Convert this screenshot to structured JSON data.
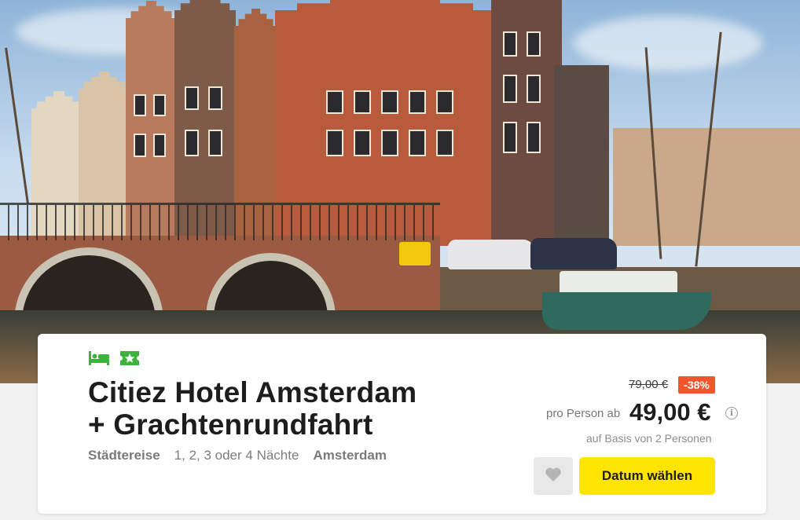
{
  "hero": {
    "image_alt_icon": "amsterdam-canal-photo"
  },
  "offer": {
    "feature_icons": [
      "bed-icon",
      "ticket-star-icon"
    ],
    "title_line1": "Citiez Hotel Amsterdam",
    "title_line2": "+ Grachtenrundfahrt",
    "category": "Städtereise",
    "nights": "1, 2, 3 oder 4 Nächte",
    "location": "Amsterdam",
    "old_price": "79,00 €",
    "discount": "-38%",
    "per_person_label": "pro Person ab",
    "price": "49,00 €",
    "info_symbol": "i",
    "basis_note": "auf Basis von 2 Personen",
    "favorite_icon": "heart-icon",
    "cta_label": "Datum wählen"
  },
  "colors": {
    "feature_green": "#3db33d",
    "discount_bg": "#f0552d",
    "cta_bg": "#ffe400",
    "text_dark": "#1d1d1d"
  }
}
